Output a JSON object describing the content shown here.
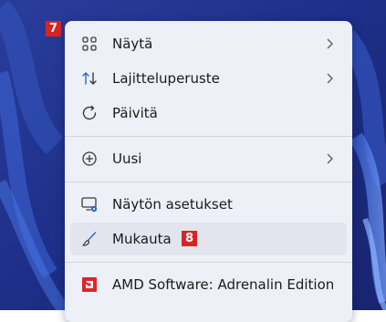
{
  "step_badges": {
    "first": "7",
    "second": "8"
  },
  "context_menu": {
    "items": [
      {
        "label": "Näytä",
        "icon": "grid-view-icon",
        "has_submenu": true
      },
      {
        "label": "Lajitteluperuste",
        "icon": "sort-arrows-icon",
        "has_submenu": true
      },
      {
        "label": "Päivitä",
        "icon": "refresh-icon",
        "has_submenu": false
      },
      {
        "label": "Uusi",
        "icon": "plus-circle-icon",
        "has_submenu": true
      },
      {
        "label": "Näytön asetukset",
        "icon": "display-settings-icon",
        "has_submenu": false
      },
      {
        "label": "Mukauta",
        "icon": "paintbrush-icon",
        "has_submenu": false,
        "highlighted": true
      },
      {
        "label": "AMD Software: Adrenalin Edition",
        "icon": "amd-logo-icon",
        "has_submenu": false
      }
    ]
  },
  "colors": {
    "accent": "#2a68c8",
    "badge": "#d92424",
    "amd_red": "#e0242a",
    "menu_background": "#eef0f8",
    "hover_background": "#e2e5ee"
  }
}
